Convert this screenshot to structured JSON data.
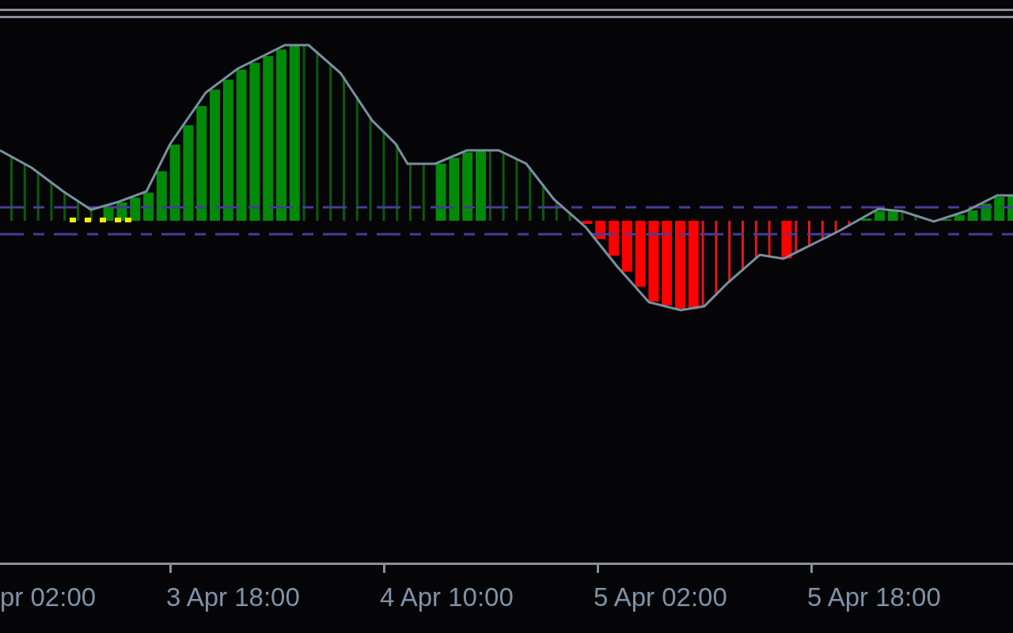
{
  "time_axis": {
    "labels": [
      "pr 02:00",
      "3 Apr 18:00",
      "4 Apr 10:00",
      "5 Apr 02:00",
      "5 Apr 18:00"
    ]
  }
}
